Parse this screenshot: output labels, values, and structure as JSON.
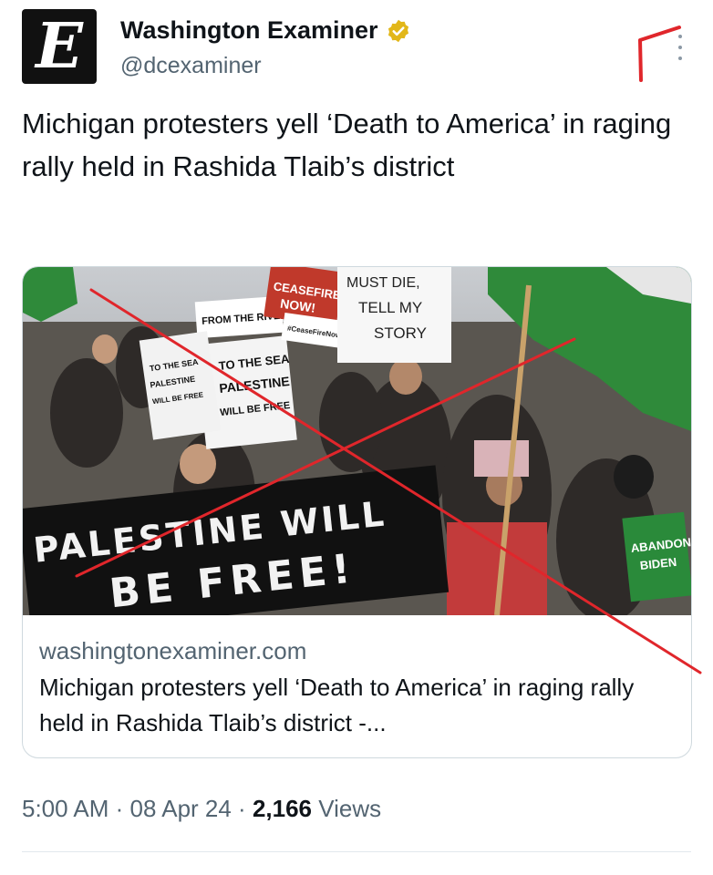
{
  "account": {
    "avatar_letter": "E",
    "name": "Washington Examiner",
    "handle": "@dcexaminer",
    "verified_icon": "verified-badge-icon"
  },
  "tweet": {
    "text": "Michigan protesters yell ‘Death to America’ in raging rally held in Rashida Tlaib’s district"
  },
  "card": {
    "domain": "washingtonexaminer.com",
    "title": "Michigan protesters yell ‘Death to America’ in raging rally held in Rashida Tlaib’s district -...",
    "image": {
      "banner_line1": "PALESTINE WILL",
      "banner_line2": "BE FREE!",
      "sign_from_river": "FROM THE RIVER",
      "sign_to_sea": "TO THE SEA",
      "sign_palestine": "PALESTINE",
      "sign_will_be_free": "WILL BE FREE",
      "sign_ceasefire": "CEASEFIRE",
      "sign_now": "NOW!",
      "sign_hashtag": "#CeaseFireNow",
      "sign_story_1": "MUST DIE,",
      "sign_story_2": "TELL MY",
      "sign_story_3": "STORY",
      "sign_abandon": "ABANDON",
      "sign_biden": "BIDEN"
    }
  },
  "meta": {
    "time": "5:00 AM",
    "sep1": " · ",
    "date": "08 Apr 24",
    "sep2": " · ",
    "views_count": "2,166",
    "views_label": " Views"
  },
  "colors": {
    "text_primary": "#0f1419",
    "text_secondary": "#536471",
    "verified_gold": "#e2b719",
    "annotation_red": "#e0262b",
    "border": "#cfd9de"
  }
}
